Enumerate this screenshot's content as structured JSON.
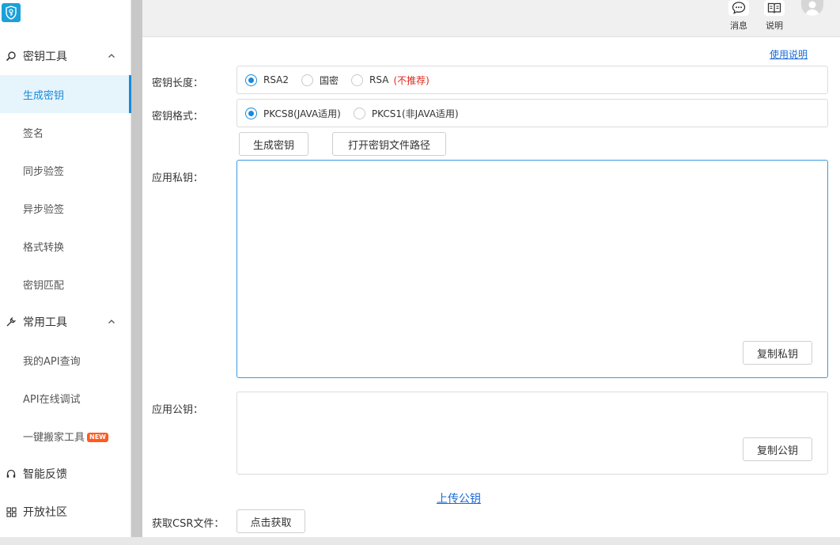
{
  "sidebar": {
    "groups": [
      {
        "label": "密钥工具",
        "icon": "search-icon",
        "expanded": true
      },
      {
        "label": "常用工具",
        "icon": "wrench-icon",
        "expanded": true
      },
      {
        "label": "智能反馈",
        "icon": "headset-icon"
      },
      {
        "label": "开放社区",
        "icon": "grid-icon"
      }
    ],
    "key_items": [
      "生成密钥",
      "签名",
      "同步验签",
      "异步验签",
      "格式转换",
      "密钥匹配"
    ],
    "common_items": [
      "我的API查询",
      "API在线调试",
      "一键搬家工具"
    ],
    "new_badge": "NEW",
    "active_item": "生成密钥"
  },
  "header": {
    "messages_label": "消息",
    "docs_label": "说明"
  },
  "main": {
    "help_link": "使用说明",
    "key_length": {
      "label": "密钥长度：",
      "options": [
        "RSA2",
        "国密",
        "RSA"
      ],
      "selected": "RSA2",
      "rsa_note": "(不推荐)"
    },
    "key_format": {
      "label": "密钥格式：",
      "options": [
        "PKCS8(JAVA适用)",
        "PKCS1(非JAVA适用)"
      ],
      "selected": "PKCS8(JAVA适用)"
    },
    "generate_button": "生成密钥",
    "open_path_button": "打开密钥文件路径",
    "private_key": {
      "label": "应用私钥：",
      "value": "",
      "copy_button": "复制私钥"
    },
    "public_key": {
      "label": "应用公钥：",
      "value": "",
      "copy_button": "复制公钥"
    },
    "upload_public_key": "上传公钥",
    "csr": {
      "label": "获取CSR文件：",
      "button": "点击获取"
    }
  },
  "colors": {
    "accent": "#1a8ad8",
    "link": "#1a6ad8",
    "warning": "#e0261b",
    "new_badge": "#ff5a1f",
    "logo": "#1aa1d9"
  }
}
